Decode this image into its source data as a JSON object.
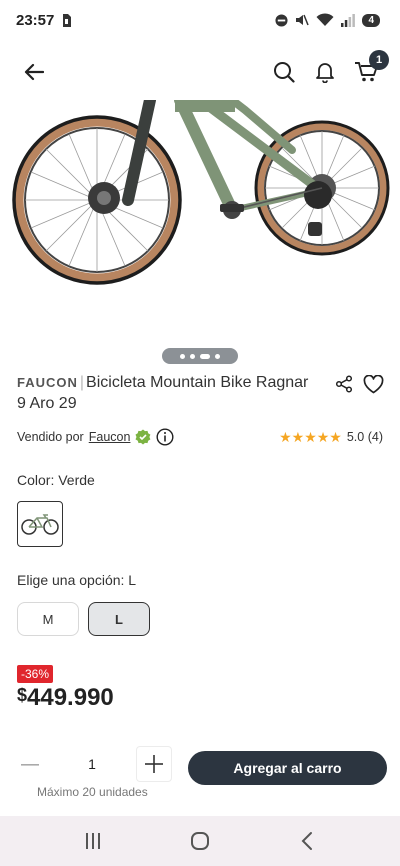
{
  "status": {
    "time": "23:57",
    "battery_level": "4"
  },
  "header": {
    "cart_count": "1"
  },
  "product": {
    "brand": "FAUCON",
    "separator": "|",
    "name": "Bicicleta Mountain Bike Ragnar 9 Aro 29",
    "seller_prefix": "Vendido por",
    "seller_name": "Faucon",
    "stars": "★★★★★",
    "rating": "5.0 (4)",
    "color_label": "Color: Verde",
    "option_label": "Elige una opción: L",
    "sizes": [
      {
        "label": "M",
        "selected": false
      },
      {
        "label": "L",
        "selected": true
      }
    ],
    "discount": "-36%",
    "currency": "$",
    "price": "449.990"
  },
  "purchase": {
    "quantity": "1",
    "add_to_cart": "Agregar al carro",
    "max_note": "Máximo 20 unidades"
  },
  "gallery": {
    "image_count": 4,
    "active_index": 2
  },
  "colors": {
    "primary_button": "#2c3540",
    "discount_badge": "#e0262d",
    "star": "#f5a623",
    "verified": "#7cb342",
    "bike_frame": "#7f9477",
    "tire_wall": "#b88560"
  }
}
